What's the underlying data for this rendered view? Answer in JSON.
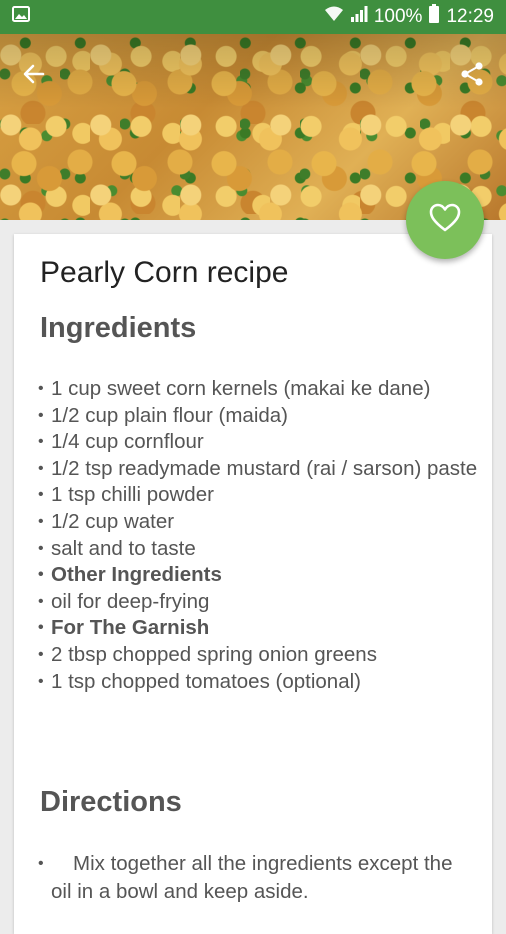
{
  "status_bar": {
    "battery": "100%",
    "time": "12:29",
    "left_icon": "image-icon",
    "right_icons": [
      "wifi-icon",
      "signal-icon",
      "battery-icon"
    ]
  },
  "header": {
    "back_icon": "arrow-left-icon",
    "share_icon": "share-icon",
    "favorite_icon": "heart-icon"
  },
  "recipe": {
    "title": "Pearly Corn recipe",
    "ingredients_heading": "Ingredients",
    "ingredients": [
      "1 cup sweet corn kernels (makai ke dane)",
      "1/2 cup plain flour (maida)",
      "1/4 cup cornflour",
      "1/2 tsp readymade mustard (rai / sarson) paste",
      "1 tsp chilli powder",
      "1/2 cup water",
      "salt and to taste",
      "Other Ingredients",
      "oil for deep-frying",
      "For The Garnish",
      "2 tbsp chopped spring onion greens",
      "1 tsp chopped tomatoes (optional)"
    ],
    "directions_heading": "Directions",
    "directions": [
      "Mix together all the ingredients except the oil in a bowl and keep aside."
    ]
  },
  "colors": {
    "status_bar": "#3f8f3f",
    "fab": "#7cc05a",
    "heading_text": "#555555",
    "title_text": "#222222"
  }
}
